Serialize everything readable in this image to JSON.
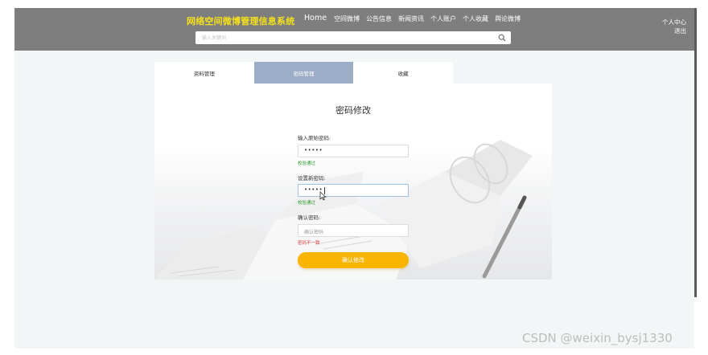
{
  "header": {
    "brand": "网络空间微博管理信息系统",
    "nav": [
      "Home",
      "空间微博",
      "公告信息",
      "新闻资讯",
      "个人账户",
      "个人收藏",
      "舆论微博"
    ],
    "user_center": "个人中心",
    "logout": "退出",
    "search_placeholder": "输入关键词"
  },
  "tabs": [
    {
      "label": "资料管理",
      "active": false
    },
    {
      "label": "密码管理",
      "active": true
    },
    {
      "label": "收藏",
      "active": false
    }
  ],
  "form": {
    "title": "密码修改",
    "old_password": {
      "label": "输入原始密码:",
      "value": "•••••",
      "hint": "校验通过"
    },
    "new_password": {
      "label": "设置新密码:",
      "value": "•••••",
      "hint": "校验通过"
    },
    "confirm_password": {
      "label": "确认密码:",
      "placeholder": "确认密码",
      "hint": "密码不一致"
    },
    "submit_label": "确认修改"
  },
  "watermark": "CSDN @weixin_bysj1330",
  "colors": {
    "header_bg": "#7e7e7e",
    "brand": "#f6e11a",
    "active_tab": "#9caec7",
    "submit": "#f7b500",
    "ok": "#2e9a2e",
    "error": "#d83a3a"
  }
}
